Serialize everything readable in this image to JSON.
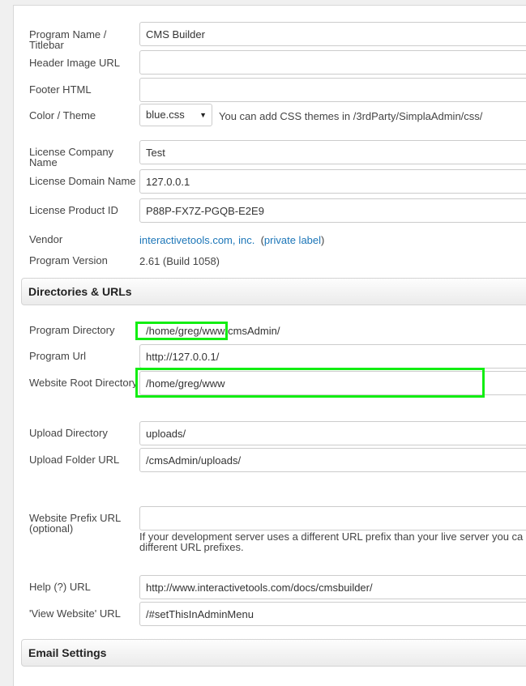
{
  "general": {
    "program_name_label": "Program Name / Titlebar",
    "program_name_value": "CMS Builder",
    "header_image_label": "Header Image URL",
    "header_image_value": "",
    "footer_html_label": "Footer HTML",
    "footer_html_value": "",
    "color_theme_label": "Color / Theme",
    "color_theme_selected": "blue.css",
    "color_theme_hint": "You can add CSS themes in /3rdParty/SimplaAdmin/css/",
    "license_company_label": "License Company Name",
    "license_company_value": "Test",
    "license_domain_label": "License Domain Name",
    "license_domain_value": "127.0.0.1",
    "license_product_label": "License Product ID",
    "license_product_value": "P88P-FX7Z-PGQB-E2E9",
    "vendor_label": "Vendor",
    "vendor_link": "interactivetools.com, inc.",
    "vendor_private_prefix": "(",
    "vendor_private_link": "private label",
    "vendor_private_suffix": ")",
    "program_version_label": "Program Version",
    "program_version_value": "2.61 (Build 1058)"
  },
  "directories": {
    "section_title": "Directories & URLs",
    "program_directory_label": "Program Directory",
    "program_directory_value": "/home/greg/www/cmsAdmin/",
    "program_url_label": "Program Url",
    "program_url_value": "http://127.0.0.1/",
    "website_root_label": "Website Root Directory",
    "website_root_value": "/home/greg/www",
    "upload_directory_label": "Upload Directory",
    "upload_directory_value": "uploads/",
    "upload_folder_url_label": "Upload Folder URL",
    "upload_folder_url_value": "/cmsAdmin/uploads/",
    "website_prefix_label": "Website Prefix URL (optional)",
    "website_prefix_value": "",
    "website_prefix_hint_line1": "If your development server uses a different URL prefix than your live server you ca",
    "website_prefix_hint_line2": "different URL prefixes.",
    "help_url_label": "Help (?) URL",
    "help_url_value": "http://www.interactivetools.com/docs/cmsbuilder/",
    "view_website_label": "'View Website' URL",
    "view_website_value": "/#setThisInAdminMenu"
  },
  "email": {
    "section_title": "Email Settings"
  },
  "colors": {
    "highlight": "#12ee12",
    "link": "#1c76b8"
  }
}
